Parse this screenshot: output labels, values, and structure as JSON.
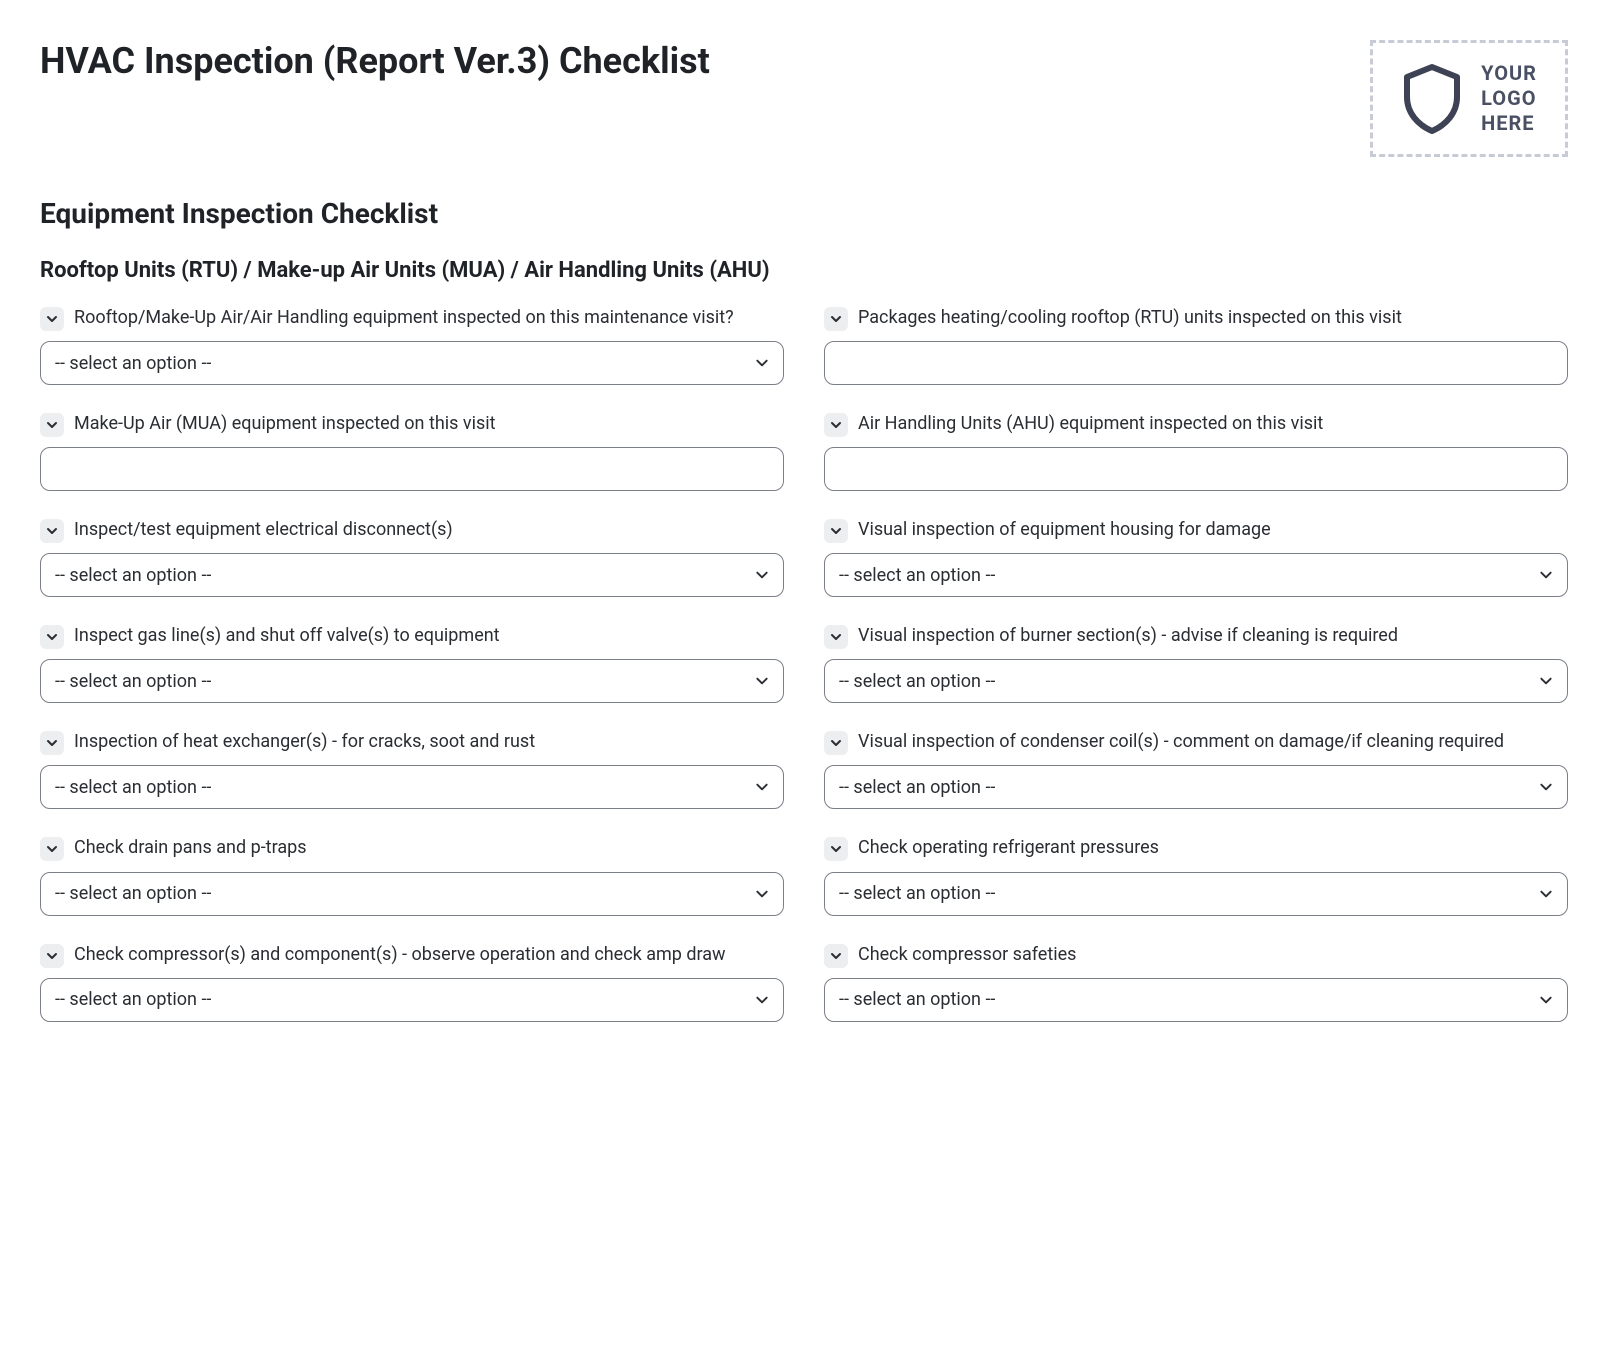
{
  "title": "HVAC Inspection (Report Ver.3) Checklist",
  "logo": {
    "line1": "YOUR",
    "line2": "LOGO",
    "line3": "HERE"
  },
  "section_title": "Equipment Inspection Checklist",
  "subsection_title": "Rooftop Units (RTU) / Make-up Air Units (MUA) / Air Handling Units (AHU)",
  "placeholder": "-- select an option --",
  "fields": {
    "f0": {
      "label": "Rooftop/Make-Up Air/Air Handling equipment inspected on this maintenance visit?",
      "type": "select"
    },
    "f1": {
      "label": "Packages heating/cooling rooftop (RTU) units inspected on this visit",
      "type": "text"
    },
    "f2": {
      "label": "Make-Up Air (MUA) equipment inspected on this visit",
      "type": "text"
    },
    "f3": {
      "label": "Air Handling Units (AHU) equipment inspected on this visit",
      "type": "text"
    },
    "f4": {
      "label": "Inspect/test equipment electrical disconnect(s)",
      "type": "select"
    },
    "f5": {
      "label": "Visual inspection of equipment housing for damage",
      "type": "select"
    },
    "f6": {
      "label": "Inspect gas line(s) and shut off valve(s) to equipment",
      "type": "select"
    },
    "f7": {
      "label": "Visual inspection of burner section(s) - advise if cleaning is required",
      "type": "select"
    },
    "f8": {
      "label": "Inspection of heat exchanger(s) - for cracks, soot and rust",
      "type": "select"
    },
    "f9": {
      "label": "Visual inspection of condenser coil(s) - comment on damage/if cleaning required",
      "type": "select"
    },
    "f10": {
      "label": "Check drain pans and p-traps",
      "type": "select"
    },
    "f11": {
      "label": "Check operating refrigerant pressures",
      "type": "select"
    },
    "f12": {
      "label": "Check compressor(s) and component(s) - observe operation and check amp draw",
      "type": "select"
    },
    "f13": {
      "label": "Check compressor safeties",
      "type": "select"
    }
  }
}
